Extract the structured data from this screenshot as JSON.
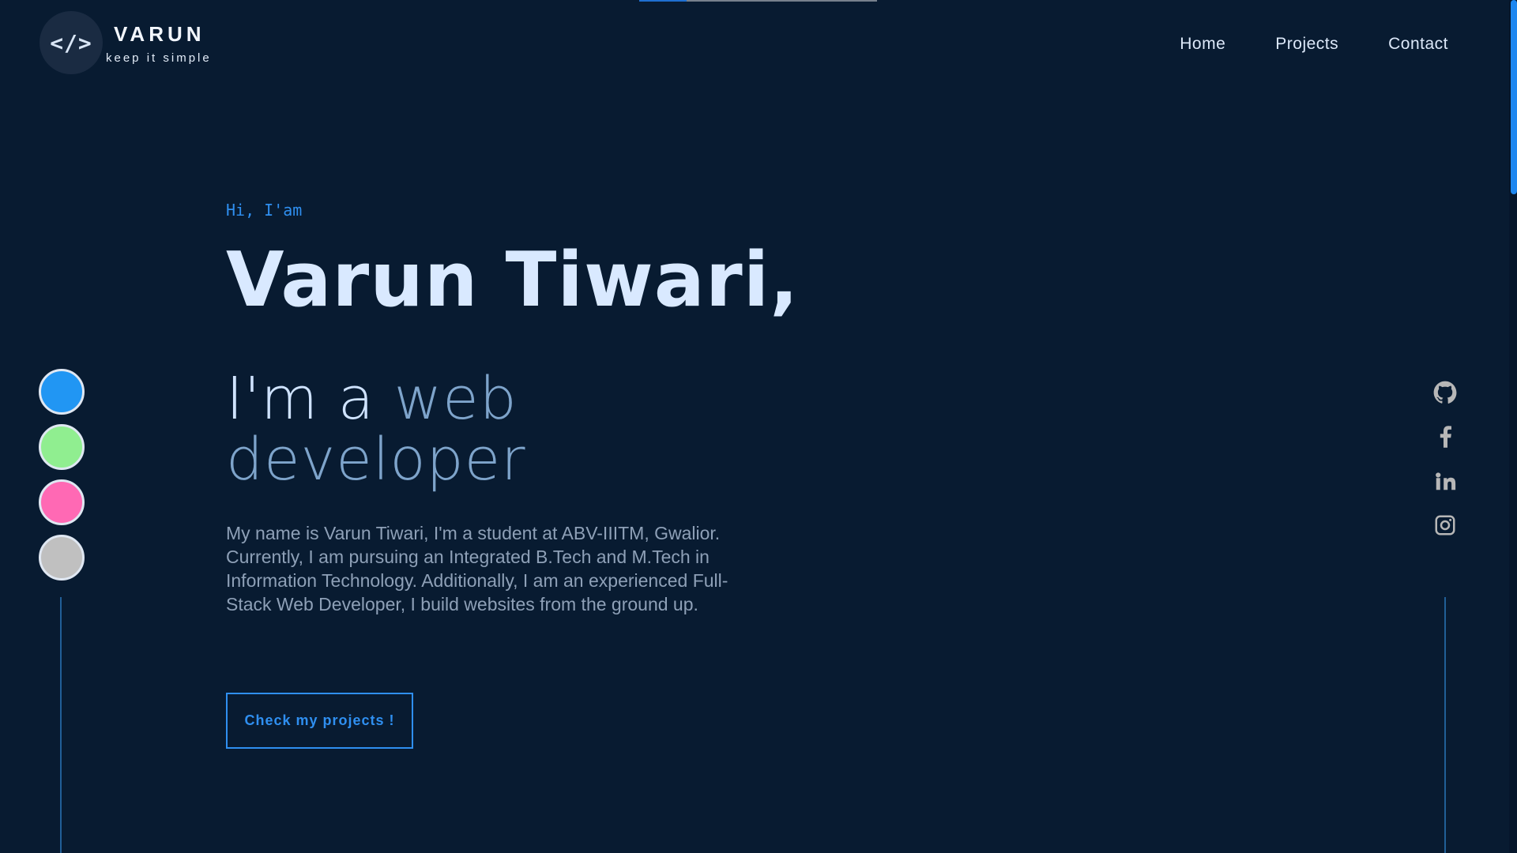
{
  "brand": {
    "logo_text": "</>",
    "name": "VARUN",
    "tagline": "keep it simple"
  },
  "nav": {
    "items": [
      {
        "label": "Home"
      },
      {
        "label": "Projects"
      },
      {
        "label": "Contact"
      }
    ]
  },
  "hero": {
    "greeting": "Hi, I'am",
    "name": "Varun Tiwari,",
    "role_prefix": "I'm a ",
    "role_highlight": "web developer",
    "description": "My name is Varun Tiwari, I'm a student at ABV-IIITM, Gwalior. Currently, I am pursuing an Integrated B.Tech and M.Tech in Information Technology. Additionally, I am an experienced Full-Stack Web Developer, I build websites from the ground up.",
    "cta_label": "Check my projects !"
  },
  "theme_colors": [
    "#2196f3",
    "#90ee90",
    "#ff69b4",
    "#c0c0c0"
  ],
  "social_icons": [
    "github-icon",
    "facebook-icon",
    "linkedin-icon",
    "instagram-icon"
  ],
  "colors": {
    "background": "#081b31",
    "accent": "#2f8ff0",
    "text": "#d7e7ff",
    "muted": "#8ea0b7",
    "line": "#215f97"
  },
  "page_progress": {
    "value": 0.2
  }
}
